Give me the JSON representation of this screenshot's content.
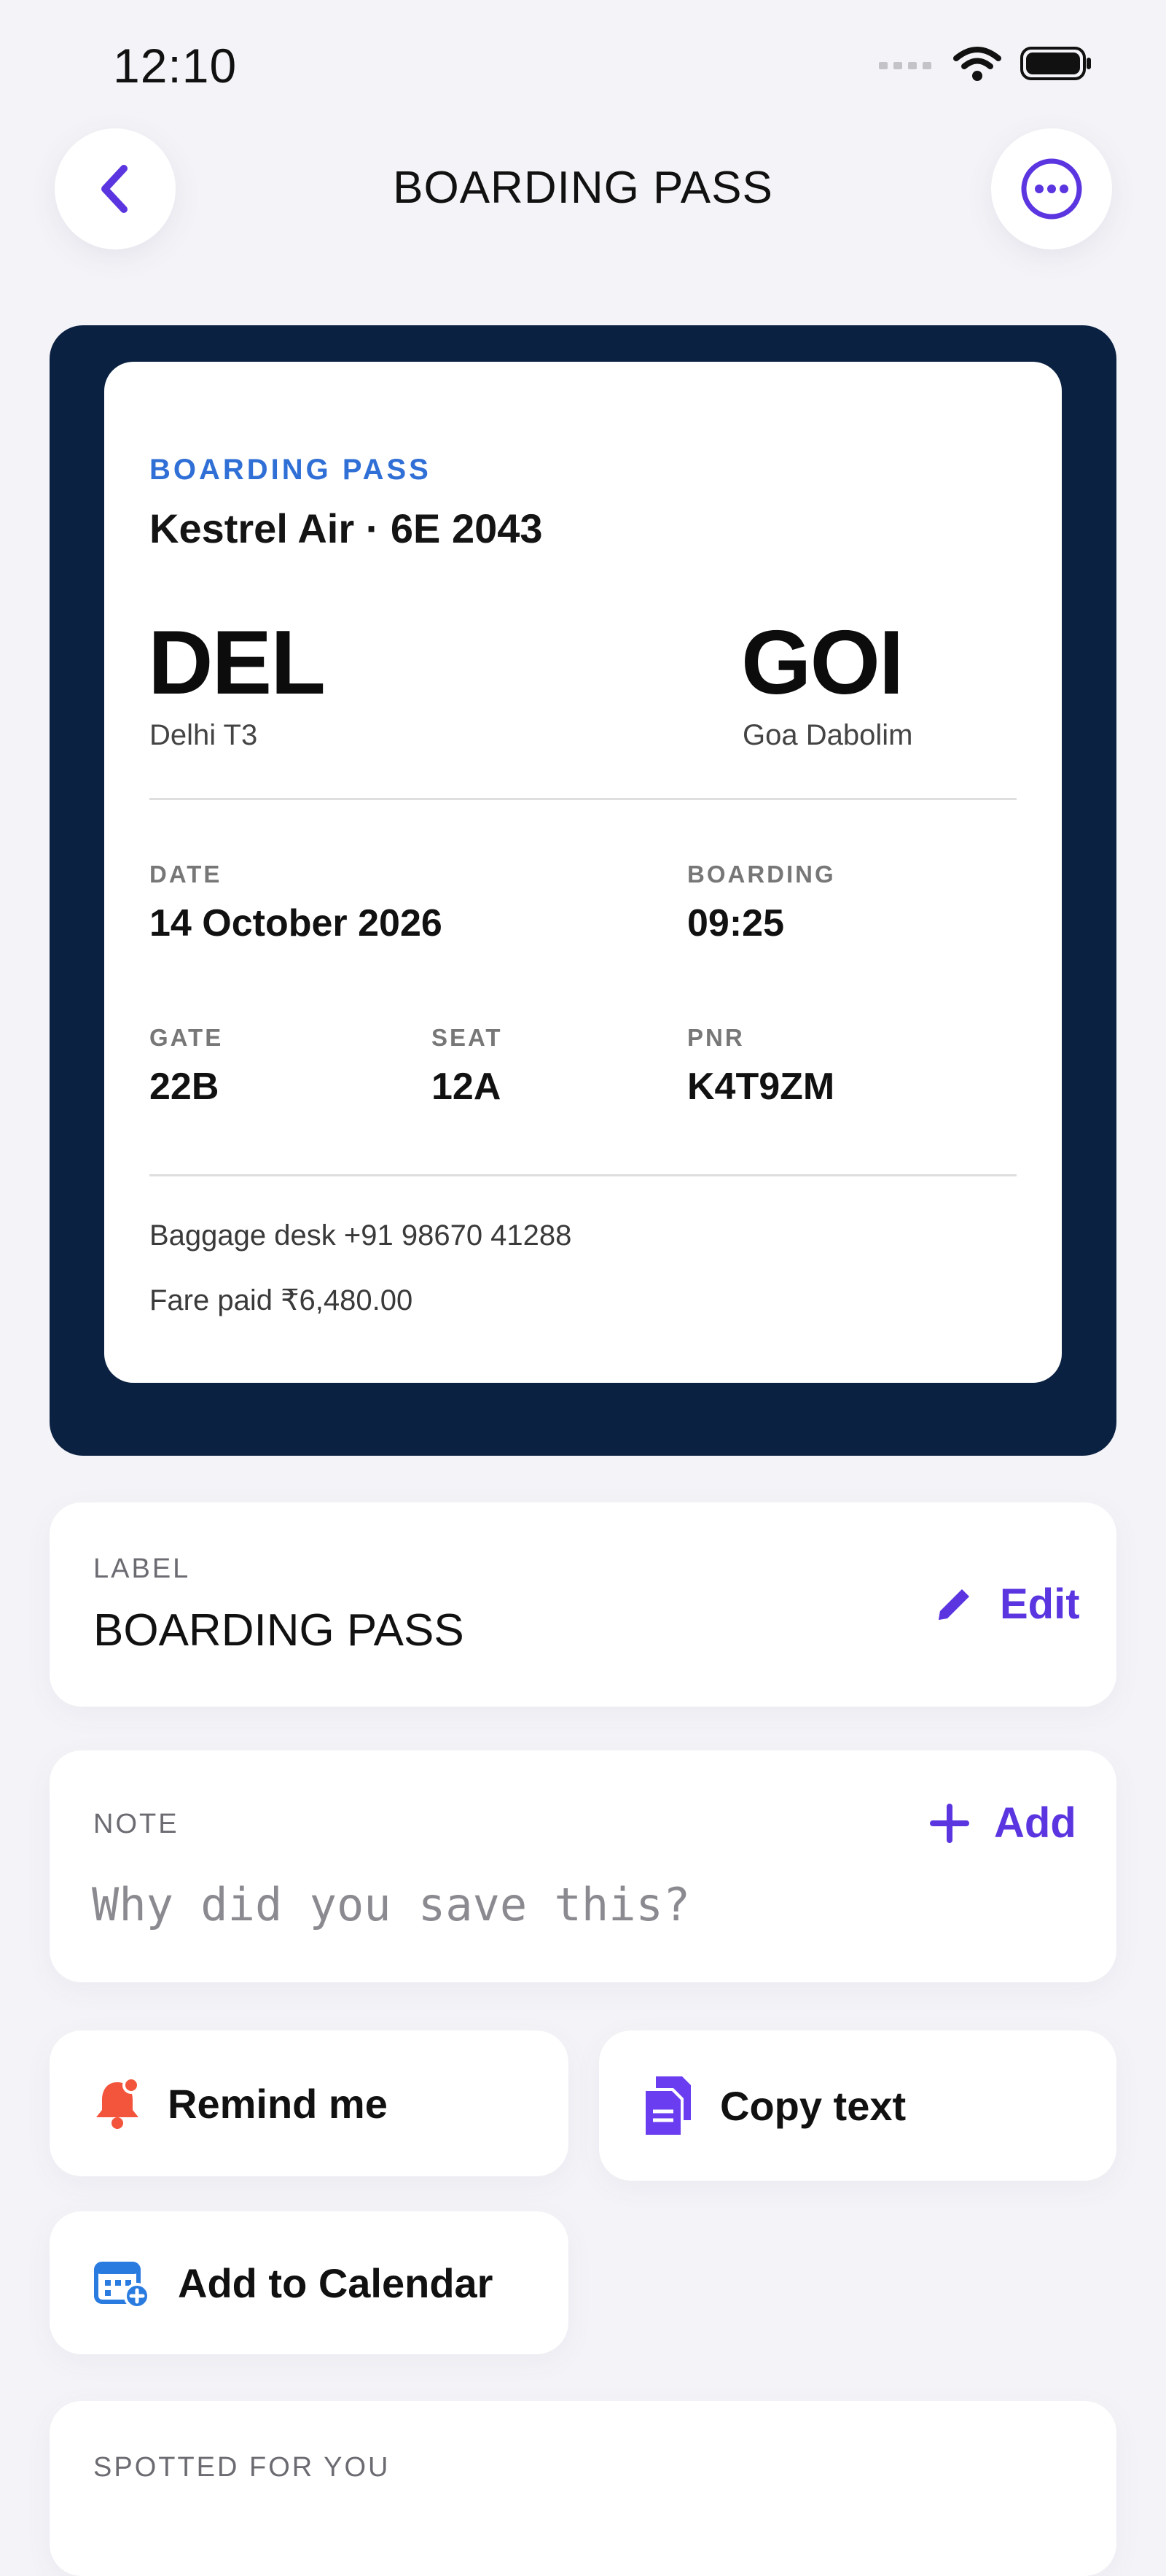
{
  "status_bar": {
    "time": "12:10"
  },
  "header": {
    "title": "BOARDING PASS",
    "back_icon": "chevron-left-icon",
    "more_icon": "ellipsis-circle-icon"
  },
  "pass": {
    "kicker": "BOARDING PASS",
    "airline_flight": "Kestrel Air · 6E 2043",
    "from_code": "DEL",
    "from_city": "Delhi T3",
    "to_code": "GOI",
    "to_city": "Goa Dabolim",
    "date_label": "DATE",
    "date_value": "14 October 2026",
    "boarding_label": "BOARDING",
    "boarding_value": "09:25",
    "gate_label": "GATE",
    "gate_value": "22B",
    "seat_label": "SEAT",
    "seat_value": "12A",
    "pnr_label": "PNR",
    "pnr_value": "K4T9ZM",
    "baggage_line": "Baggage desk +91 98670 41288",
    "fare_line": "Fare paid ₹6,480.00"
  },
  "label_card": {
    "heading": "LABEL",
    "value": "BOARDING PASS",
    "edit_label": "Edit"
  },
  "note_card": {
    "heading": "NOTE",
    "add_label": "Add",
    "placeholder": "Why did you save this?"
  },
  "actions": {
    "remind": "Remind me",
    "copy": "Copy text",
    "calendar": "Add to Calendar"
  },
  "spotted": {
    "heading": "SPOTTED FOR YOU"
  },
  "colors": {
    "accent": "#5b35e0",
    "panel": "#0b2142",
    "kicker": "#2f6fd6",
    "bell": "#f2553b",
    "calendar": "#2a7be0"
  }
}
